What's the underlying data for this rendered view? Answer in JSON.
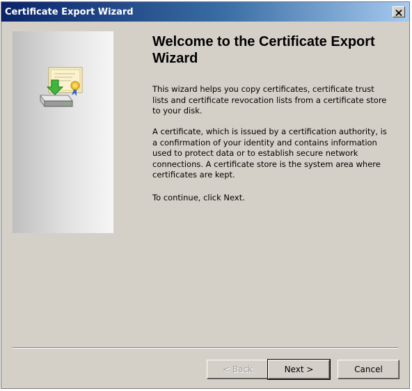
{
  "window": {
    "title": "Certificate Export Wizard",
    "close_glyph": "✕"
  },
  "side_panel": {
    "icon": "certificate-export-icon"
  },
  "content": {
    "heading": "Welcome to the Certificate Export Wizard",
    "paragraph1": "This wizard helps you copy certificates, certificate trust lists and certificate revocation lists from a certificate store to your disk.",
    "paragraph2": "A certificate, which is issued by a certification authority, is a confirmation of your identity and contains information used to protect data or to establish secure network connections. A certificate store is the system area where certificates are kept.",
    "paragraph3": "To continue, click Next."
  },
  "buttons": {
    "back": "< Back",
    "back_enabled": false,
    "next": "Next >",
    "next_default": true,
    "cancel": "Cancel"
  },
  "colors": {
    "dialog_background": "#d4d0c8",
    "titlebar_start": "#0a246a",
    "titlebar_end": "#a6caf0",
    "disabled_text": "#a0a0a0"
  }
}
